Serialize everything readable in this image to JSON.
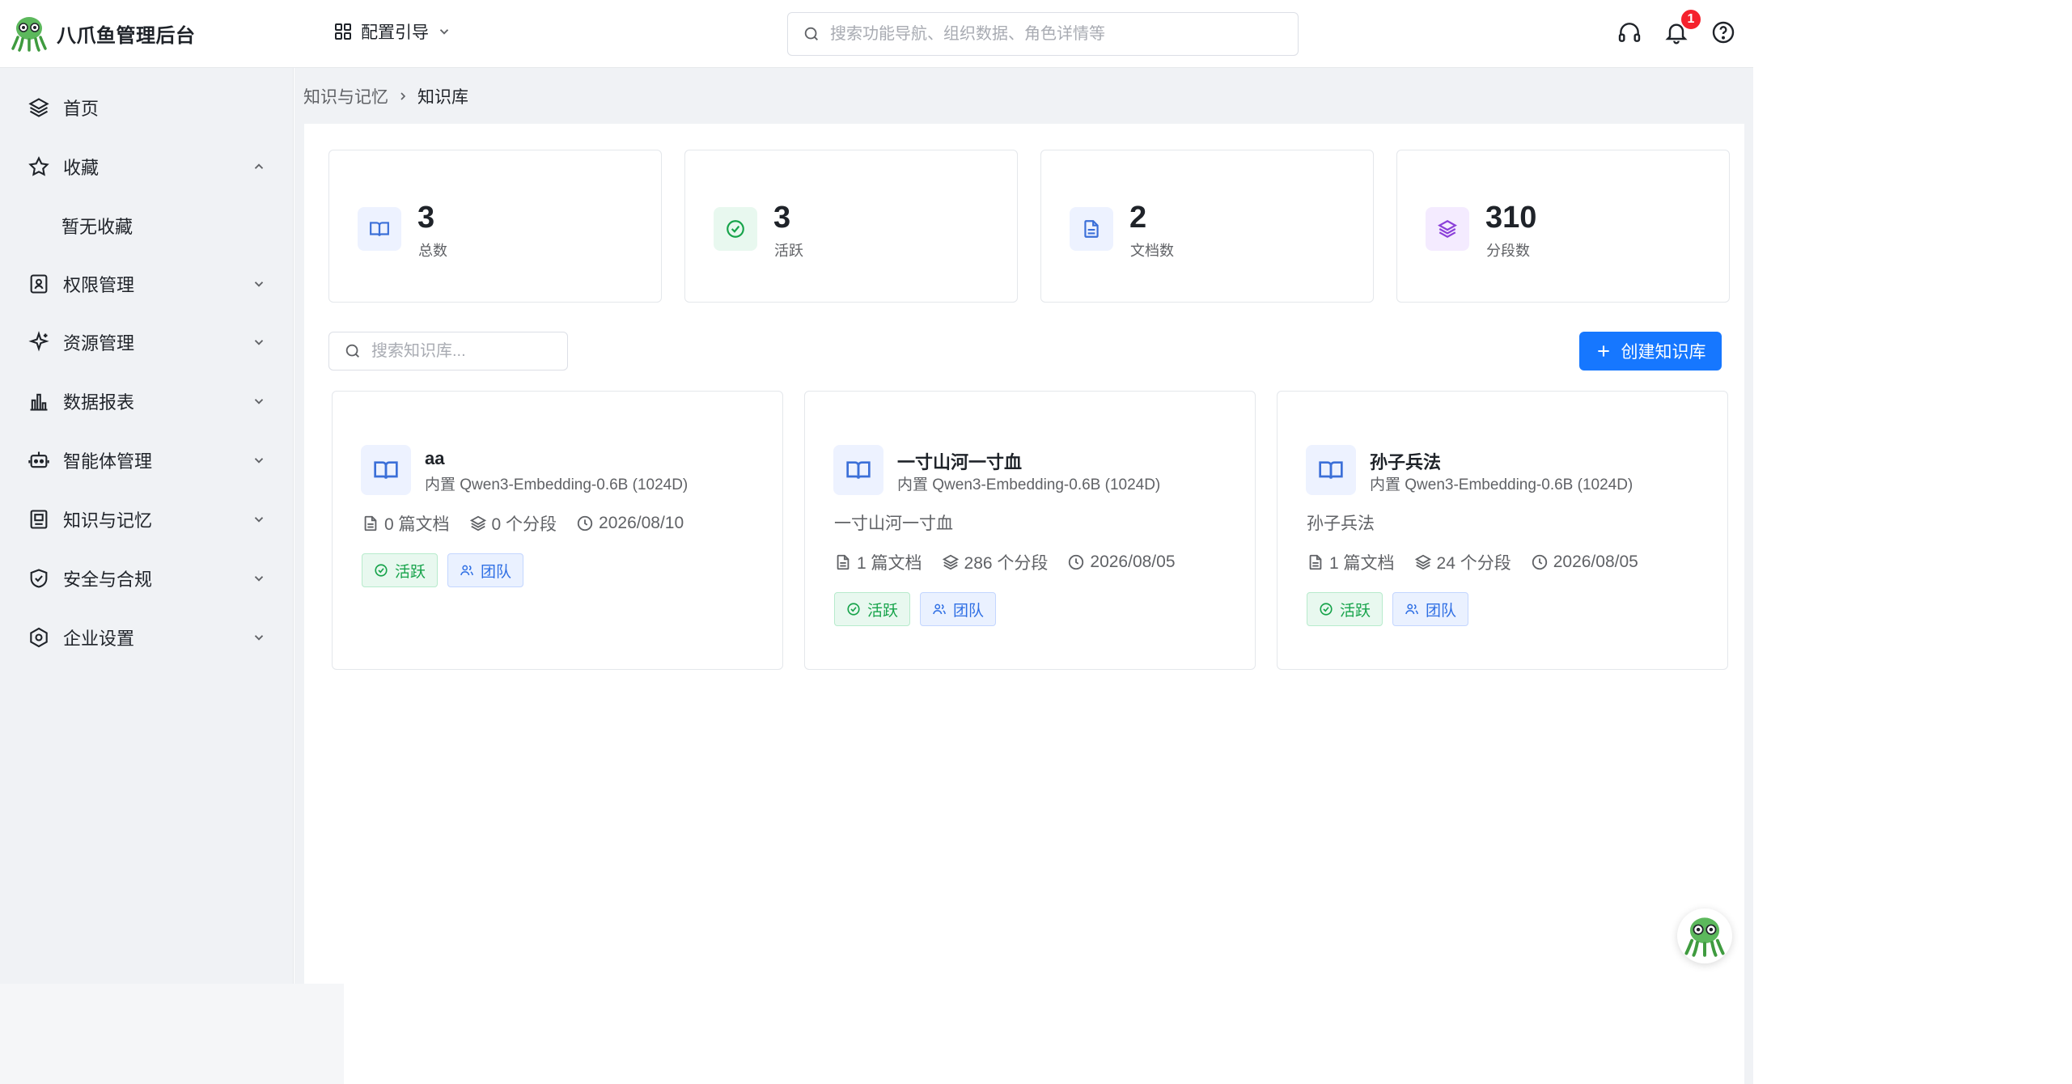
{
  "app": {
    "title": "八爪鱼管理后台"
  },
  "header": {
    "guide_label": "配置引导",
    "search_placeholder": "搜索功能导航、组织数据、角色详情等",
    "notification_count": "1"
  },
  "sidebar": {
    "items": [
      {
        "label": "首页",
        "icon": "layers-icon"
      },
      {
        "label": "收藏",
        "icon": "star-icon",
        "expanded": true
      },
      {
        "label": "权限管理",
        "icon": "id-card-icon"
      },
      {
        "label": "资源管理",
        "icon": "sparkle-icon"
      },
      {
        "label": "数据报表",
        "icon": "bar-chart-icon"
      },
      {
        "label": "智能体管理",
        "icon": "robot-icon"
      },
      {
        "label": "知识与记忆",
        "icon": "book-box-icon"
      },
      {
        "label": "安全与合规",
        "icon": "shield-check-icon"
      },
      {
        "label": "企业设置",
        "icon": "hexagon-settings-icon"
      }
    ],
    "favorites_empty": "暂无收藏"
  },
  "breadcrumb": {
    "parent": "知识与记忆",
    "current": "知识库"
  },
  "stats": [
    {
      "value": "3",
      "label": "总数",
      "color": "#3b6fd8",
      "bg": "#edf2ff"
    },
    {
      "value": "3",
      "label": "活跃",
      "color": "#16a34a",
      "bg": "#e8f8ef"
    },
    {
      "value": "2",
      "label": "文档数",
      "color": "#3b6fd8",
      "bg": "#edf2ff"
    },
    {
      "value": "310",
      "label": "分段数",
      "color": "#8b3fd9",
      "bg": "#f4ebff"
    }
  ],
  "toolbar": {
    "search_placeholder": "搜索知识库...",
    "create_label": "创建知识库"
  },
  "knowledge_bases": [
    {
      "name": "aa",
      "model": "内置 Qwen3-Embedding-0.6B (1024D)",
      "description": "",
      "docs": "0 篇文档",
      "segments": "0 个分段",
      "date": "2026/08/10",
      "tag_status": "活跃",
      "tag_scope": "团队"
    },
    {
      "name": "一寸山河一寸血",
      "model": "内置 Qwen3-Embedding-0.6B (1024D)",
      "description": "一寸山河一寸血",
      "docs": "1 篇文档",
      "segments": "286 个分段",
      "date": "2026/08/05",
      "tag_status": "活跃",
      "tag_scope": "团队"
    },
    {
      "name": "孙子兵法",
      "model": "内置 Qwen3-Embedding-0.6B (1024D)",
      "description": "孙子兵法",
      "docs": "1 篇文档",
      "segments": "24 个分段",
      "date": "2026/08/05",
      "tag_status": "活跃",
      "tag_scope": "团队"
    }
  ],
  "colors": {
    "primary": "#1677ff",
    "success": "#16a34a",
    "purple": "#8b3fd9",
    "danger": "#f5222d"
  }
}
